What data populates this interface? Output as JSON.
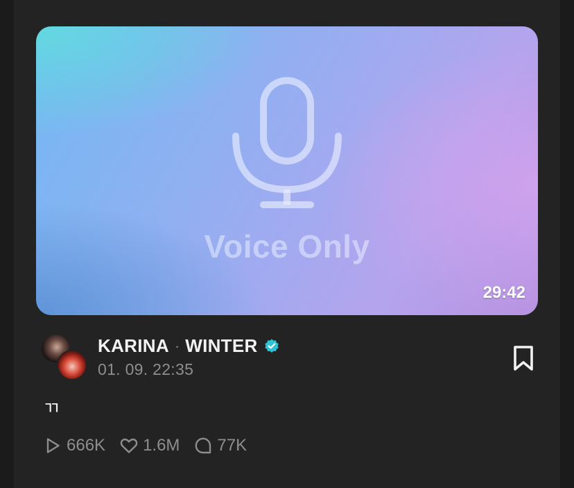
{
  "media": {
    "label": "Voice Only",
    "duration": "29:42",
    "icon": "microphone-icon"
  },
  "author": {
    "name_1": "KARINA",
    "separator": "·",
    "name_2": "WINTER",
    "verified_icon": "verified-badge-icon",
    "verified_color": "#2bc3d6",
    "timestamp": "01. 09. 22:35"
  },
  "post": {
    "text": "ㄲ"
  },
  "stats": {
    "plays": "666K",
    "likes": "1.6M",
    "comments": "77K"
  },
  "actions": {
    "bookmark_icon": "bookmark-icon"
  }
}
